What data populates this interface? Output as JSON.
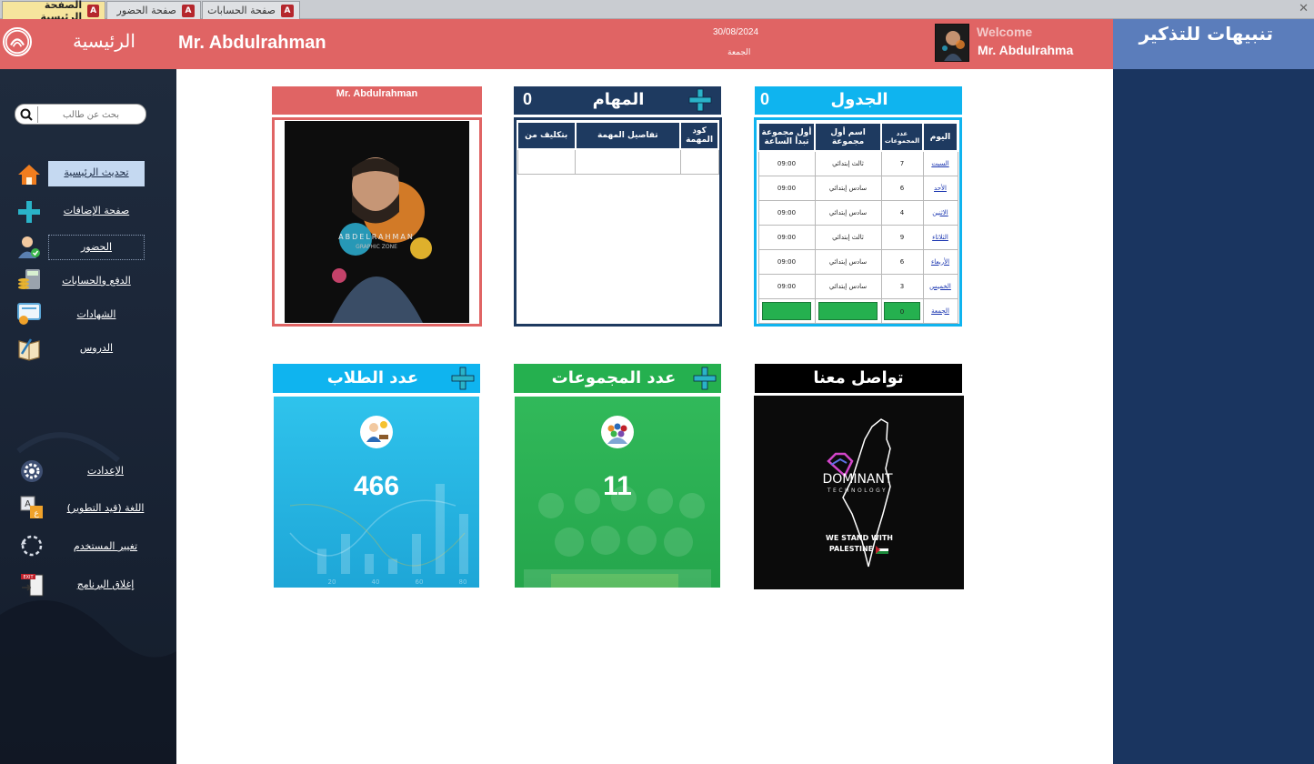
{
  "tabs": [
    {
      "label": "الصفحة الرئيسية",
      "active": true
    },
    {
      "label": "صفحة الحضور",
      "active": false
    },
    {
      "label": "صفحة الحسابات",
      "active": false
    }
  ],
  "header": {
    "title": "الرئيسية",
    "user": "Mr. Abdulrahman",
    "date": "30/08/2024",
    "day": "الجمعة",
    "welcome": "Welcome",
    "welcome_name": "Mr. Abdulrahma"
  },
  "right_panel": {
    "title": "تنبيهات للتذكير"
  },
  "sidebar": {
    "search_placeholder": "بحث عن طالب",
    "items": [
      {
        "label": "تحديث الرئيسية",
        "icon": "home-icon"
      },
      {
        "label": "صفحة الإضافات",
        "icon": "plus-icon"
      },
      {
        "label": "الحضور",
        "icon": "attendance-icon"
      },
      {
        "label": "الدفع والحسابات",
        "icon": "calculator-icon"
      },
      {
        "label": "الشهادات",
        "icon": "certificate-icon"
      },
      {
        "label": "الدروس",
        "icon": "book-icon"
      }
    ],
    "bottom_items": [
      {
        "label": "الإعدادت",
        "icon": "gear-icon"
      },
      {
        "label": "اللغة (قيد التطوير)",
        "icon": "language-icon"
      },
      {
        "label": "تغيير المستخدم",
        "icon": "refresh-icon"
      },
      {
        "label": "إغلاق البرنامج",
        "icon": "exit-icon"
      }
    ]
  },
  "profile_card": {
    "name": "Mr. Abdulrahman",
    "photo_caption": "ABDELRAHMAN",
    "photo_subcaption": "GRAPHIC ZONE"
  },
  "tasks_card": {
    "title": "المهام",
    "count": "0",
    "columns": [
      "كود المهمة",
      "تفاصيل المهمة",
      "بتكليف من"
    ]
  },
  "schedule_card": {
    "title": "الجدول",
    "count": "0",
    "columns": [
      "اليوم",
      "عدد المجموعات",
      "اسم أول مجموعة",
      "أول مجموعة تبدأ الساعة"
    ],
    "rows": [
      {
        "day": "السبت",
        "groups": "7",
        "first": "ثالث إبتدائي",
        "time": "09:00"
      },
      {
        "day": "الأحد",
        "groups": "6",
        "first": "سادس إبتدائي",
        "time": "09:00"
      },
      {
        "day": "الاثنين",
        "groups": "4",
        "first": "سادس إبتدائي",
        "time": "09:00"
      },
      {
        "day": "الثلاثاء",
        "groups": "9",
        "first": "ثالث إبتدائي",
        "time": "09:00"
      },
      {
        "day": "الأربعاء",
        "groups": "6",
        "first": "سادس إبتدائي",
        "time": "09:00"
      },
      {
        "day": "الخميس",
        "groups": "3",
        "first": "سادس إبتدائي",
        "time": "09:00"
      },
      {
        "day": "الجمعة",
        "groups": "0",
        "first": "",
        "time": ""
      }
    ]
  },
  "students_card": {
    "title": "عدد الطلاب",
    "value": "466",
    "ticks": [
      "20",
      "40",
      "60",
      "80"
    ],
    "bar_levels": [
      0.25,
      0.4,
      0.2,
      0.15,
      0.4,
      0.9,
      0.6
    ],
    "icon": "student-icon"
  },
  "groups_card": {
    "title": "عدد المجموعات",
    "value": "11",
    "icon": "group-icon"
  },
  "contact_card": {
    "title": "تواصل معنا",
    "brand": "DOMINANT",
    "brand_sub": "TECHNOLOGY",
    "slogan_1": "WE STAND WITH",
    "slogan_2": "PALESTINE"
  },
  "colors": {
    "header": "#e06464",
    "sidebar": "#1f2b3d",
    "right_panel": "#1a3560",
    "tasks": "#1e3a60",
    "schedule": "#0fb4ef",
    "students": "#2bb6e6",
    "groups": "#25b04f",
    "contact": "#000000"
  }
}
